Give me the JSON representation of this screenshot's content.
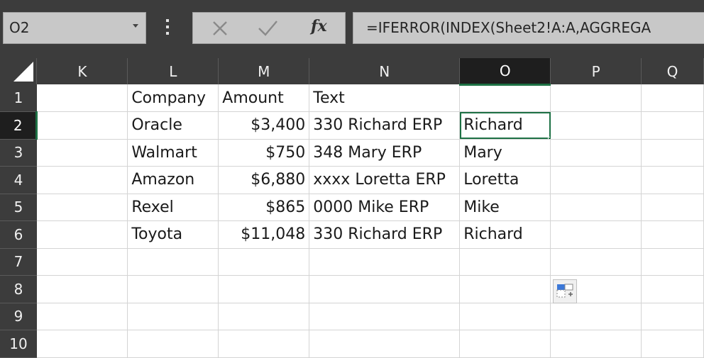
{
  "formula_bar": {
    "name_box": "O2",
    "formula": "=IFERROR(INDEX(Sheet2!A:A,AGGREGA",
    "fx_label": "fx"
  },
  "columns": [
    "K",
    "L",
    "M",
    "N",
    "O",
    "P",
    "Q"
  ],
  "selected_column": "O",
  "row_numbers": [
    "1",
    "2",
    "3",
    "4",
    "5",
    "6",
    "7",
    "8",
    "9",
    "10"
  ],
  "selected_row": "2",
  "rows": [
    {
      "K": "",
      "L": "Company",
      "M": "Amount",
      "N": "Text",
      "O": "",
      "P": "",
      "Q": ""
    },
    {
      "K": "",
      "L": "Oracle",
      "M": "$3,400",
      "N": "330 Richard ERP",
      "O": "Richard",
      "P": "",
      "Q": ""
    },
    {
      "K": "",
      "L": "Walmart",
      "M": "$750",
      "N": "348 Mary ERP",
      "O": "Mary",
      "P": "",
      "Q": ""
    },
    {
      "K": "",
      "L": "Amazon",
      "M": "$6,880",
      "N": "xxxx Loretta ERP",
      "O": "Loretta",
      "P": "",
      "Q": ""
    },
    {
      "K": "",
      "L": "Rexel",
      "M": "$865",
      "N": "0000 Mike ERP",
      "O": "Mike",
      "P": "",
      "Q": ""
    },
    {
      "K": "",
      "L": "Toyota",
      "M": "$11,048",
      "N": "330 Richard ERP",
      "O": "Richard",
      "P": "",
      "Q": ""
    },
    {
      "K": "",
      "L": "",
      "M": "",
      "N": "",
      "O": "",
      "P": "",
      "Q": ""
    },
    {
      "K": "",
      "L": "",
      "M": "",
      "N": "",
      "O": "",
      "P": "",
      "Q": ""
    },
    {
      "K": "",
      "L": "",
      "M": "",
      "N": "",
      "O": "",
      "P": "",
      "Q": ""
    },
    {
      "K": "",
      "L": "",
      "M": "",
      "N": "",
      "O": "",
      "P": "",
      "Q": ""
    }
  ],
  "icons": {
    "name_box_dropdown": "chevron-down-icon",
    "more_options": "vertical-ellipsis-icon",
    "cancel": "close-icon",
    "enter": "check-icon",
    "insert_function": "fx-icon",
    "select_all": "select-all-corner-icon",
    "quick_analysis": "quick-analysis-icon"
  },
  "colors": {
    "selection_accent": "#1e7145",
    "header_bg": "#3c3c3c",
    "selected_header_bg": "#1e1e1e"
  }
}
